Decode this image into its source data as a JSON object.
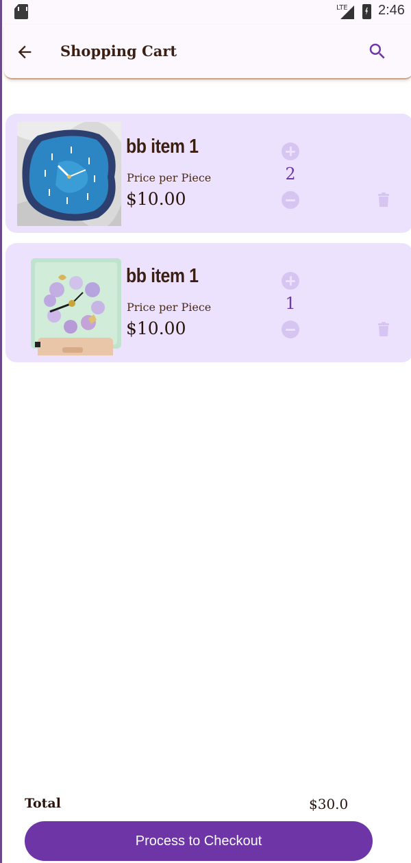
{
  "status_bar": {
    "network": "LTE",
    "time": "2:46"
  },
  "app_bar": {
    "title": "Shopping Cart",
    "back_icon": "arrow-left-icon",
    "search_icon": "search-icon"
  },
  "cart": {
    "items": [
      {
        "name": "bb item 1",
        "price_label": "Price per Piece",
        "price": "$10.00",
        "quantity": "2",
        "image": "blue-resin-wall-clock"
      },
      {
        "name": "bb item 1",
        "price_label": "Price per Piece",
        "price": "$10.00",
        "quantity": "1",
        "image": "floral-glass-desk-clock"
      }
    ]
  },
  "footer": {
    "total_label": "Total",
    "total_value": "$30.0",
    "checkout_label": "Process to Checkout"
  },
  "colors": {
    "accent": "#6d35a6",
    "card_bg": "#ece2fd",
    "app_bar_bg": "#fdf8fd",
    "text_dark": "#3a1f12",
    "quantity": "#6b3aa6",
    "icon_muted": "#d6c5f0"
  }
}
